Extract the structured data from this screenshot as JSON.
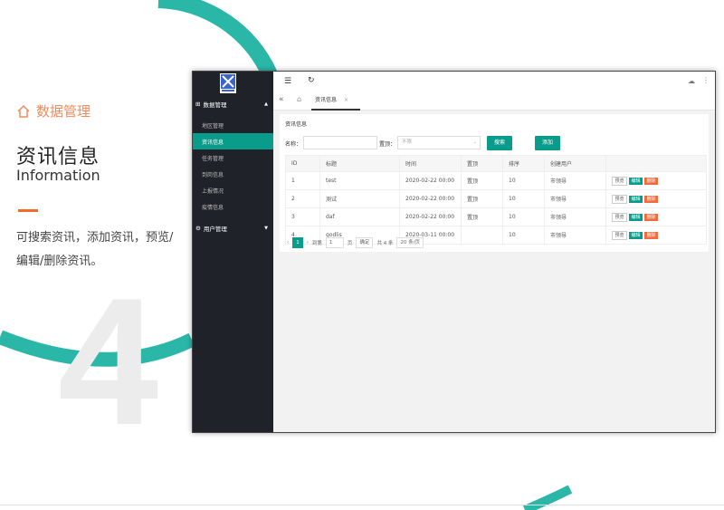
{
  "intro": {
    "section_title": "数据管理",
    "main_title": "资讯信息",
    "subtitle": "Information",
    "description": "可搜索资讯，添加资讯，预览/编辑/删除资讯。",
    "big_number": "4"
  },
  "sidebar": {
    "groups": [
      {
        "label": "数据管理",
        "expanded": true,
        "items": [
          "地区管理",
          "资讯信息",
          "任务管理",
          "到岗信息",
          "上报情况",
          "疫情信息"
        ],
        "active_index": 1
      },
      {
        "label": "用户管理",
        "expanded": false,
        "items": []
      }
    ]
  },
  "tabs": {
    "active": "资讯信息",
    "close": "×"
  },
  "panel": {
    "title": "资讯信息",
    "name_label": "名称：",
    "top_label": "置顶：",
    "top_placeholder": "不限",
    "search_button": "搜索",
    "add_button": "添加"
  },
  "table": {
    "columns": [
      "ID",
      "标题",
      "时间",
      "置顶",
      "排序",
      "创建用户",
      ""
    ],
    "rows": [
      {
        "id": "1",
        "title": "test",
        "time": "2020-02-22 00:00",
        "top": "置顶",
        "order": "10",
        "creator": "市领导"
      },
      {
        "id": "2",
        "title": "测试",
        "time": "2020-02-22 00:00",
        "top": "置顶",
        "order": "10",
        "creator": "市领导"
      },
      {
        "id": "3",
        "title": "daf",
        "time": "2020-02-22 00:00",
        "top": "置顶",
        "order": "10",
        "creator": "市领导"
      },
      {
        "id": "4",
        "title": "godlis",
        "time": "2020-03-11 00:00",
        "top": "",
        "order": "10",
        "creator": "市领导"
      }
    ],
    "actions": {
      "preview": "预览",
      "edit": "编辑",
      "delete": "删除"
    }
  },
  "pager": {
    "current": "1",
    "goto_label": "到第",
    "goto_value": "1",
    "page_label": "页",
    "confirm": "确定",
    "total": "共 4 条",
    "page_size": "20 条/页"
  },
  "colors": {
    "teal": "#0a9c8b",
    "orange": "#f06a2c",
    "sidebar": "#20222a"
  }
}
